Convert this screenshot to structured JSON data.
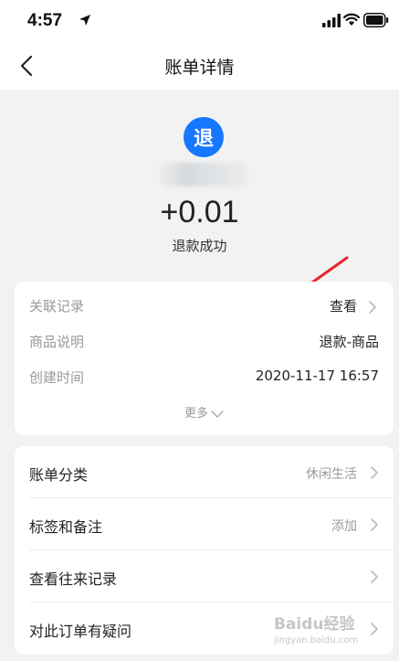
{
  "status_bar": {
    "time": "4:57"
  },
  "nav": {
    "title": "账单详情"
  },
  "header": {
    "badge": "退",
    "amount": "+0.01",
    "status": "退款成功"
  },
  "details": {
    "rows": [
      {
        "label": "关联记录",
        "value": "查看"
      },
      {
        "label": "商品说明",
        "value": "退款-商品"
      },
      {
        "label": "创建时间",
        "value": "2020-11-17 16:57"
      }
    ],
    "more": "更多"
  },
  "actions": [
    {
      "label": "账单分类",
      "value": "休闲生活"
    },
    {
      "label": "标签和备注",
      "value": "添加"
    },
    {
      "label": "查看往来记录",
      "value": ""
    },
    {
      "label": "对此订单有疑问",
      "value": ""
    }
  ],
  "watermark": {
    "line1": "Baidu经验",
    "line2": "jingyan.baidu.com"
  },
  "colors": {
    "accent": "#1677ff",
    "arrow": "#e8242a"
  }
}
